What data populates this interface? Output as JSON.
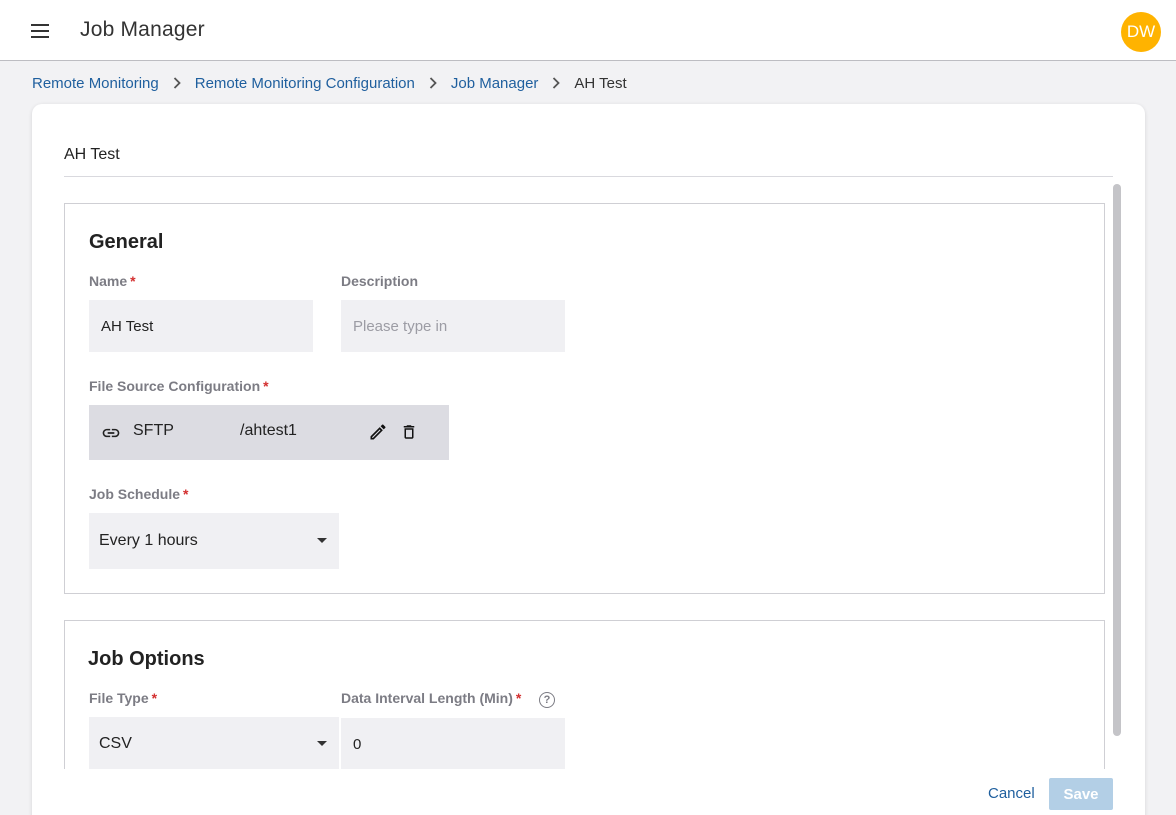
{
  "app": {
    "title": "Job Manager",
    "avatar_initials": "DW",
    "avatar_color": "#ffb300",
    "menu_icon": "hamburger-menu-icon"
  },
  "breadcrumb": {
    "items": [
      "Remote Monitoring",
      "Remote Monitoring Configuration",
      "Job Manager"
    ],
    "current": "AH Test",
    "separator_icon": "chevron-right-icon"
  },
  "card": {
    "title": "AH Test"
  },
  "general": {
    "title": "General",
    "name_label": "Name",
    "name_value": "AH Test",
    "description_label": "Description",
    "description_placeholder": "Please type in",
    "file_source_label": "File Source Configuration",
    "file_source": {
      "icon": "link-icon",
      "protocol": "SFTP",
      "path": "/ahtest1",
      "edit_icon": "pencil-icon",
      "delete_icon": "trash-icon"
    },
    "schedule_label": "Job Schedule",
    "schedule_value": "Every 1 hours"
  },
  "job_options": {
    "title": "Job Options",
    "file_type_label": "File Type",
    "file_type_value": "CSV",
    "interval_label": "Data Interval Length (Min)",
    "interval_value": "0",
    "help_icon": "question-circle-icon",
    "help_glyph": "?"
  },
  "required_mark": "*",
  "footer": {
    "cancel_label": "Cancel",
    "save_label": "Save"
  },
  "colors": {
    "link": "#1f5f9e",
    "required": "#d32f2f",
    "save_disabled": "#b3cfe6"
  }
}
